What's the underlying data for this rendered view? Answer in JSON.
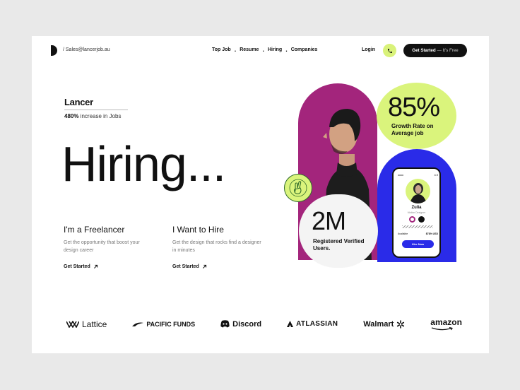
{
  "header": {
    "email": "/ Sales@lancerjob.au",
    "nav": [
      "Top Job",
      "Resume",
      "Hiring",
      "Companies"
    ],
    "login": "Login",
    "cta_main": "Get Started",
    "cta_suffix": "— It's Free"
  },
  "hero": {
    "brand": "Lancer",
    "increase_bold": "480%",
    "increase_rest": " increase in Jobs",
    "title": "Hiring...",
    "columns": [
      {
        "heading": "I'm a Freelancer",
        "text": "Get the opportunity that boost your design career",
        "link": "Get Started"
      },
      {
        "heading": "I Want to Hire",
        "text": "Get the design that rocks find a designer in minutes",
        "link": "Get Started"
      }
    ]
  },
  "stats": {
    "growth_value": "85%",
    "growth_label": "Growth Rate on Average job",
    "users_value": "2M",
    "users_label": "Registered Verified Users."
  },
  "phone": {
    "rating": "4.9",
    "name": "Zulia",
    "role": "Motion Designer",
    "availability_label": "Available",
    "rate": "$75/h USD",
    "button": "Hire Now"
  },
  "partners": [
    "Lattice",
    "PACIFIC FUNDS",
    "Discord",
    "ATLASSIAN",
    "Walmart",
    "amazon"
  ],
  "colors": {
    "accent_lime": "#daf47c",
    "accent_purple": "#a3257c",
    "accent_blue": "#2a2be8",
    "dark": "#111111"
  }
}
